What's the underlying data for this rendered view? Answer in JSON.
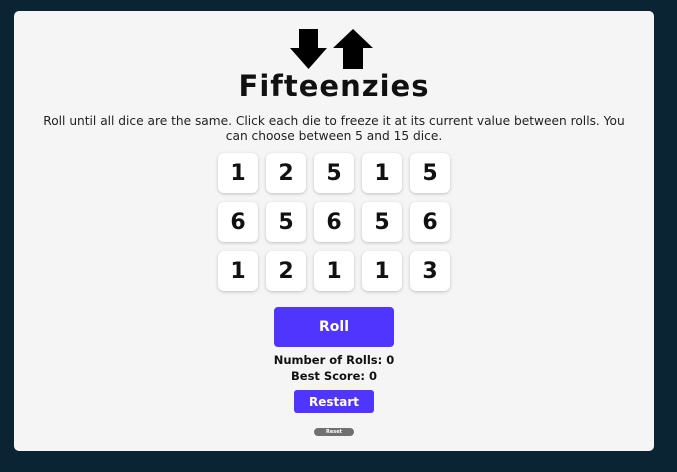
{
  "header": {
    "icons": [
      "arrow-down-icon",
      "arrow-up-icon"
    ],
    "title": "Fifteenzies",
    "description": "Roll until all dice are the same. Click each die to freeze it at its current value between rolls. You can choose between 5 and 15 dice."
  },
  "dice": [
    {
      "value": "1"
    },
    {
      "value": "2"
    },
    {
      "value": "5"
    },
    {
      "value": "1"
    },
    {
      "value": "5"
    },
    {
      "value": "6"
    },
    {
      "value": "5"
    },
    {
      "value": "6"
    },
    {
      "value": "5"
    },
    {
      "value": "6"
    },
    {
      "value": "1"
    },
    {
      "value": "2"
    },
    {
      "value": "1"
    },
    {
      "value": "1"
    },
    {
      "value": "3"
    }
  ],
  "controls": {
    "roll_label": "Roll",
    "restart_label": "Restart",
    "reset_label": "Reset"
  },
  "stats": {
    "rolls_text": "Number of Rolls: 0",
    "best_text": "Best Score: 0"
  },
  "colors": {
    "background": "#0b2434",
    "panel": "#f5f5f5",
    "accent": "#5035ff",
    "reset_button": "#707070"
  }
}
